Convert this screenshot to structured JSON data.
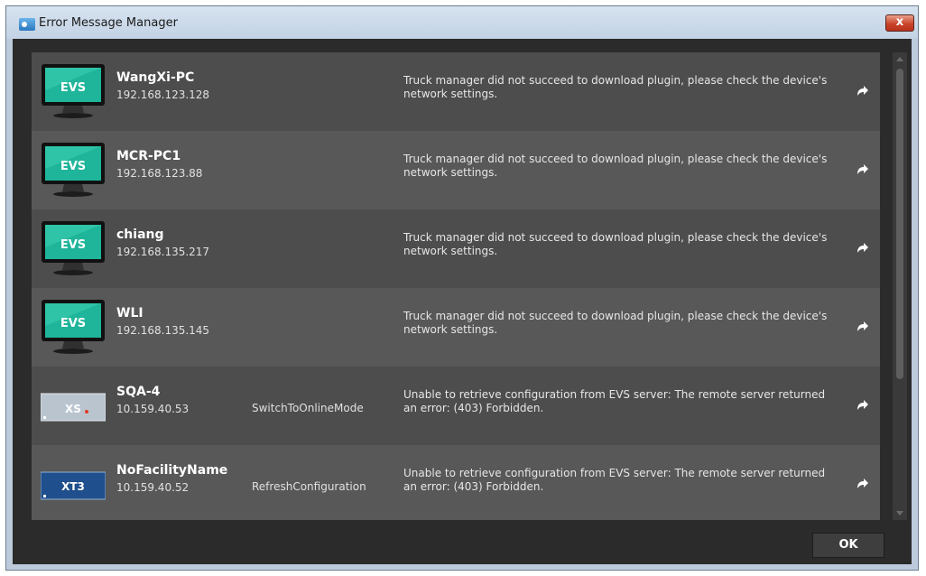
{
  "window": {
    "title": "Error Message Manager",
    "close_label": "x"
  },
  "rows": [
    {
      "device_type": "evs-workstation",
      "name": "WangXi-PC",
      "ip": "192.168.123.128",
      "operation": "",
      "message": "Truck manager did not succeed to download plugin, please check the device's network settings."
    },
    {
      "device_type": "evs-workstation",
      "name": "MCR-PC1",
      "ip": "192.168.123.88",
      "operation": "",
      "message": "Truck manager did not succeed to download plugin, please check the device's network settings."
    },
    {
      "device_type": "evs-workstation",
      "name": "chiang",
      "ip": "192.168.135.217",
      "operation": "",
      "message": "Truck manager did not succeed to download plugin, please check the device's network settings."
    },
    {
      "device_type": "evs-workstation",
      "name": "WLI",
      "ip": "192.168.135.145",
      "operation": "",
      "message": "Truck manager did not succeed to download plugin, please check the device's network settings."
    },
    {
      "device_type": "xs-server",
      "badge": "XS",
      "name": "SQA-4",
      "ip": "10.159.40.53",
      "operation": "SwitchToOnlineMode",
      "message": "Unable to retrieve configuration from EVS server: The remote server returned an error: (403) Forbidden."
    },
    {
      "device_type": "xt3-server",
      "badge": "XT3",
      "name": "NoFacilityName",
      "ip": "10.159.40.52",
      "operation": "RefreshConfiguration",
      "message": "Unable to retrieve configuration from EVS server: The remote server returned an error: (403) Forbidden."
    }
  ],
  "monitor_logo": "EVS",
  "footer": {
    "ok_label": "OK"
  },
  "colors": {
    "row_dark": "#4d4d4d",
    "row_light": "#585858",
    "panel": "#2b2b2b",
    "accent_green": "#1fb59a"
  }
}
